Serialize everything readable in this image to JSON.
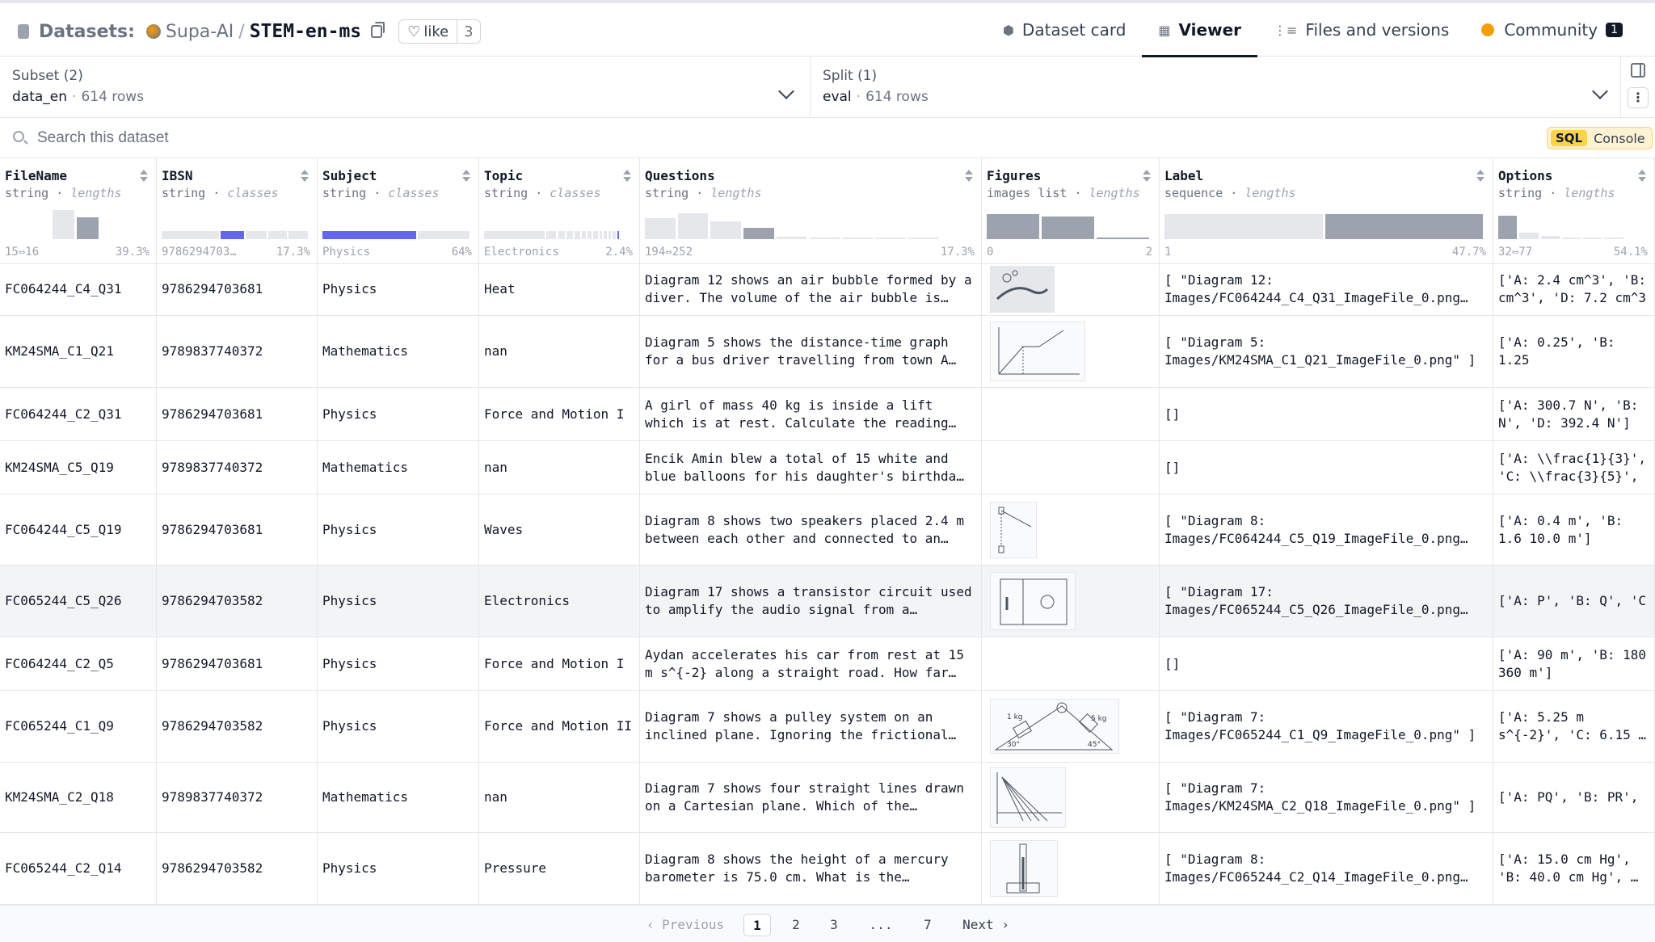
{
  "header": {
    "prefix": "Datasets:",
    "org": "Supa-AI",
    "separator": "/",
    "repo": "STEM-en-ms",
    "like_label": "like",
    "like_count": "3",
    "tabs": [
      {
        "label": "Dataset card",
        "icon": "dataset-card-icon"
      },
      {
        "label": "Viewer",
        "icon": "table-icon",
        "active": true
      },
      {
        "label": "Files and versions",
        "icon": "files-icon"
      },
      {
        "label": "Community",
        "icon": "community-icon",
        "badge": "1"
      }
    ]
  },
  "subset": {
    "title": "Subset (2)",
    "value": "data_en",
    "rows": "614 rows"
  },
  "split": {
    "title": "Split (1)",
    "value": "eval",
    "rows": "614 rows"
  },
  "search": {
    "placeholder": "Search this dataset"
  },
  "sql_console": {
    "badge": "SQL",
    "label": "Console"
  },
  "columns": [
    {
      "name": "FileName",
      "type": "string",
      "stat_kind": "lengths",
      "stat_left": "15⇔16",
      "stat_right": "39.3%",
      "chart": "hist",
      "bars": [
        0.0,
        0.0,
        1.0,
        0.75,
        0.0,
        0.0
      ],
      "highlight": 3
    },
    {
      "name": "IBSN",
      "type": "string",
      "stat_kind": "classes",
      "stat_left": "9786294703…",
      "stat_right": "17.3%",
      "chart": "classes",
      "bars": [
        0.4,
        0.17,
        0.15,
        0.14,
        0.14
      ]
    },
    {
      "name": "Subject",
      "type": "string",
      "stat_kind": "classes",
      "stat_left": "Physics",
      "stat_right": "64%",
      "chart": "classes-full",
      "bars": [
        0.64,
        0.36
      ]
    },
    {
      "name": "Topic",
      "type": "string",
      "stat_kind": "classes",
      "stat_left": "Electronics",
      "stat_right": "2.4%",
      "chart": "classes-many",
      "bars": [
        0.42,
        0.08,
        0.06,
        0.05,
        0.05,
        0.04,
        0.04,
        0.04,
        0.03,
        0.03,
        0.03,
        0.03,
        0.024
      ]
    },
    {
      "name": "Questions",
      "type": "string",
      "stat_kind": "lengths",
      "stat_left": "194⇔252",
      "stat_right": "17.3%",
      "chart": "hist",
      "bars": [
        0.72,
        0.9,
        0.62,
        0.38,
        0.08,
        0.05,
        0.03,
        0.02,
        0.01,
        0.0
      ],
      "highlight": 3
    },
    {
      "name": "Figures",
      "type": "images list",
      "stat_kind": "lengths",
      "stat_left": "0",
      "stat_right": "2",
      "chart": "hist3",
      "bars": [
        0.85,
        0.78,
        0.05
      ]
    },
    {
      "name": "Label",
      "type": "sequence",
      "stat_kind": "lengths",
      "stat_left": "1",
      "stat_right": "47.7%",
      "chart": "hist2",
      "bars": [
        0.85,
        0.85
      ],
      "highlight": 1
    },
    {
      "name": "Options",
      "type": "string",
      "stat_kind": "lengths",
      "stat_left": "32⇔77",
      "stat_right": "54.1%",
      "chart": "hist",
      "bars": [
        0.8,
        0.22,
        0.12,
        0.06,
        0.04,
        0.02,
        0.0
      ],
      "highlight": 0
    }
  ],
  "rows": [
    {
      "filename": "FC064244_C4_Q31",
      "ibsn": "9786294703681",
      "subject": "Physics",
      "topic": "Heat",
      "question": "Diagram 12 shows an air bubble formed by a diver. The volume of the air bubble is…",
      "figure": "diver",
      "label": "[ \"Diagram 12: Images/FC064244_C4_Q31_ImageFile_0.png…",
      "options": "['A: 2.4 cm^3', 'B: cm^3', 'D: 7.2 cm^3"
    },
    {
      "filename": "KM24SMA_C1_Q21",
      "ibsn": "9789837740372",
      "subject": "Mathematics",
      "topic": "nan",
      "question": "Diagram 5 shows the distance-time graph for a bus driver travelling from town A…",
      "figure": "graph",
      "label": "[ \"Diagram 5: Images/KM24SMA_C1_Q21_ImageFile_0.png\" ]",
      "options": "['A: 0.25', 'B: 1.25"
    },
    {
      "filename": "FC064244_C2_Q31",
      "ibsn": "9786294703681",
      "subject": "Physics",
      "topic": "Force and Motion I",
      "question": "A girl of mass 40 kg is inside a lift which is at rest. Calculate the reading…",
      "figure": "",
      "label": "[]",
      "options": "['A: 300.7 N', 'B: N', 'D: 392.4 N']"
    },
    {
      "filename": "KM24SMA_C5_Q19",
      "ibsn": "9789837740372",
      "subject": "Mathematics",
      "topic": "nan",
      "question": "Encik Amin blew a total of 15 white and blue balloons for his daughter's birthda…",
      "figure": "",
      "label": "[]",
      "options": "['A: \\\\frac{1}{3}', 'C: \\\\frac{3}{5}',"
    },
    {
      "filename": "FC064244_C5_Q19",
      "ibsn": "9786294703681",
      "subject": "Physics",
      "topic": "Waves",
      "question": "Diagram 8 shows two speakers placed 2.4 m between each other and connected to an…",
      "figure": "speakers",
      "label": "[ \"Diagram 8: Images/FC064244_C5_Q19_ImageFile_0.png…",
      "options": "['A: 0.4 m', 'B: 1.6 10.0 m']"
    },
    {
      "filename": "FC065244_C5_Q26",
      "ibsn": "9786294703582",
      "subject": "Physics",
      "topic": "Electronics",
      "question": "Diagram 17 shows a transistor circuit used to amplify the audio signal from a…",
      "figure": "circuit",
      "label": "[ \"Diagram 17: Images/FC065244_C5_Q26_ImageFile_0.png…",
      "options": "['A: P', 'B: Q', 'C"
    },
    {
      "filename": "FC064244_C2_Q5",
      "ibsn": "9786294703681",
      "subject": "Physics",
      "topic": "Force and Motion I",
      "question": "Aydan accelerates his car from rest at 15 m s^{-2} along a straight road. How far…",
      "figure": "",
      "label": "[]",
      "options": "['A: 90 m', 'B: 180 360 m']"
    },
    {
      "filename": "FC065244_C1_Q9",
      "ibsn": "9786294703582",
      "subject": "Physics",
      "topic": "Force and Motion II",
      "question": "Diagram 7 shows a pulley system on an inclined plane. Ignoring the frictional…",
      "figure": "pulley",
      "label": "[ \"Diagram 7: Images/FC065244_C1_Q9_ImageFile_0.png\" ]",
      "options": "['A: 5.25 m s^{-2}', 'C: 6.15 m s^{-2}',",
      "figure_text": {
        "left_mass": "1 kg",
        "right_mass": "5 kg",
        "left_angle": "30°",
        "right_angle": "45°"
      }
    },
    {
      "filename": "KM24SMA_C2_Q18",
      "ibsn": "9789837740372",
      "subject": "Mathematics",
      "topic": "nan",
      "question": "Diagram 7 shows four straight lines drawn on a Cartesian plane. Which of the…",
      "figure": "lines",
      "label": "[ \"Diagram 7: Images/KM24SMA_C2_Q18_ImageFile_0.png\" ]",
      "options": "['A: PQ', 'B: PR',"
    },
    {
      "filename": "FC065244_C2_Q14",
      "ibsn": "9786294703582",
      "subject": "Physics",
      "topic": "Pressure",
      "question": "Diagram 8 shows the height of a mercury barometer is 75.0 cm. What is the…",
      "figure": "barometer",
      "label": "[ \"Diagram 8: Images/FC065244_C2_Q14_ImageFile_0.png…",
      "options": "['A: 15.0 cm Hg', 'B: 40.0 cm Hg', 'D: 60"
    }
  ],
  "pagination": {
    "previous": "Previous",
    "pages": [
      "1",
      "2",
      "3",
      "...",
      "7"
    ],
    "current": "1",
    "next": "Next"
  },
  "colors": {
    "accent": "#6366f1",
    "bar": "#9ca3af",
    "bar_light": "#e5e7eb",
    "highlight_row": "#f3f4f6"
  }
}
